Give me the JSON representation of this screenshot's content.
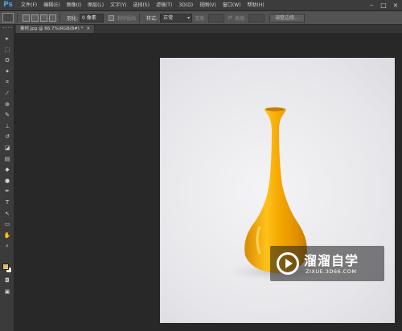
{
  "app": {
    "logo": "Ps"
  },
  "menu": [
    "文件(F)",
    "编辑(E)",
    "图像(I)",
    "图层(L)",
    "文字(Y)",
    "选择(S)",
    "滤镜(T)",
    "3D(D)",
    "视图(V)",
    "窗口(W)",
    "帮助(H)"
  ],
  "window_controls": {
    "minimize": "–",
    "maximize": "□",
    "close": "×"
  },
  "options": {
    "feather_label": "羽化:",
    "feather_value": "0 像素",
    "antialias_label": "消除锯齿",
    "style_label": "样式:",
    "style_value": "正常",
    "width_label": "宽度:",
    "swap_icon": "⇄",
    "height_label": "高度:",
    "refine_edge_button": "调整边缘..."
  },
  "document_tab": {
    "title": "素材.jpg @ 66.7%(RGB/8#) *",
    "close": "×"
  },
  "tools": [
    {
      "name": "move-tool-icon",
      "glyph": "▸"
    },
    {
      "name": "marquee-tool-icon",
      "glyph": "⬚"
    },
    {
      "name": "lasso-tool-icon",
      "glyph": "ʘ"
    },
    {
      "name": "quick-select-tool-icon",
      "glyph": "✦"
    },
    {
      "name": "crop-tool-icon",
      "glyph": "⌗"
    },
    {
      "name": "eyedropper-tool-icon",
      "glyph": "⁄"
    },
    {
      "name": "healing-brush-tool-icon",
      "glyph": "⊕"
    },
    {
      "name": "brush-tool-icon",
      "glyph": "✎"
    },
    {
      "name": "clone-stamp-tool-icon",
      "glyph": "⊥"
    },
    {
      "name": "history-brush-tool-icon",
      "glyph": "↺"
    },
    {
      "name": "eraser-tool-icon",
      "glyph": "◪"
    },
    {
      "name": "gradient-tool-icon",
      "glyph": "▤"
    },
    {
      "name": "blur-tool-icon",
      "glyph": "◆"
    },
    {
      "name": "dodge-tool-icon",
      "glyph": "●"
    },
    {
      "name": "pen-tool-icon",
      "glyph": "✒"
    },
    {
      "name": "type-tool-icon",
      "glyph": "T"
    },
    {
      "name": "path-select-tool-icon",
      "glyph": "↖"
    },
    {
      "name": "shape-tool-icon",
      "glyph": "▭"
    },
    {
      "name": "hand-tool-icon",
      "glyph": "✋"
    },
    {
      "name": "zoom-tool-icon",
      "glyph": "⌕"
    }
  ],
  "bottom_tools": [
    {
      "name": "quick-mask-icon",
      "glyph": "◘"
    },
    {
      "name": "screen-mode-icon",
      "glyph": "▣"
    }
  ],
  "colors": {
    "foreground": "#e3b96a",
    "background": "#ffffff",
    "vase": "#f5a800"
  },
  "watermark": {
    "title": "溜溜自学",
    "subtitle": "ZIXUE.3D66.COM"
  }
}
